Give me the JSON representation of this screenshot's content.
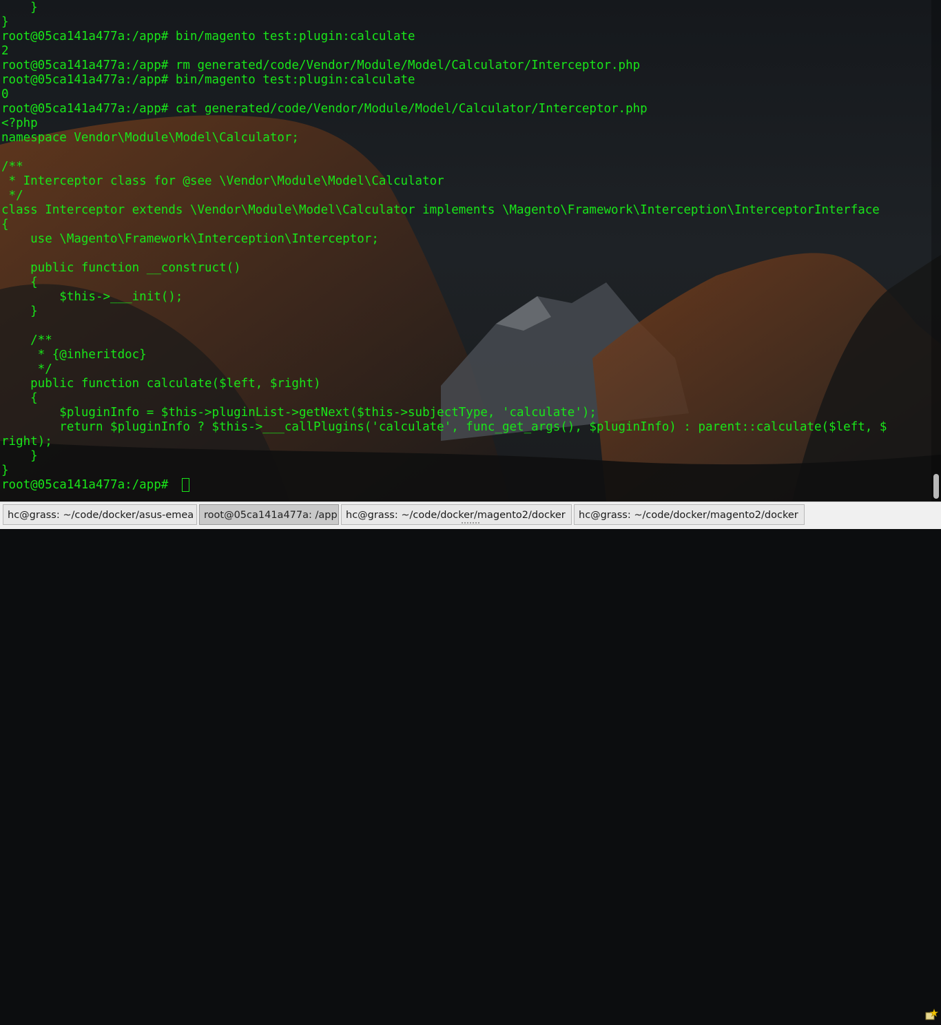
{
  "terminal": {
    "lines": [
      "    }",
      "}",
      "root@05ca141a477a:/app# bin/magento test:plugin:calculate",
      "2",
      "root@05ca141a477a:/app# rm generated/code/Vendor/Module/Model/Calculator/Interceptor.php",
      "root@05ca141a477a:/app# bin/magento test:plugin:calculate",
      "0",
      "root@05ca141a477a:/app# cat generated/code/Vendor/Module/Model/Calculator/Interceptor.php",
      "<?php",
      "namespace Vendor\\Module\\Model\\Calculator;",
      "",
      "/**",
      " * Interceptor class for @see \\Vendor\\Module\\Model\\Calculator",
      " */",
      "class Interceptor extends \\Vendor\\Module\\Model\\Calculator implements \\Magento\\Framework\\Interception\\InterceptorInterface",
      "{",
      "    use \\Magento\\Framework\\Interception\\Interceptor;",
      "",
      "    public function __construct()",
      "    {",
      "        $this->___init();",
      "    }",
      "",
      "    /**",
      "     * {@inheritdoc}",
      "     */",
      "    public function calculate($left, $right)",
      "    {",
      "        $pluginInfo = $this->pluginList->getNext($this->subjectType, 'calculate');",
      "        return $pluginInfo ? $this->___callPlugins('calculate', func_get_args(), $pluginInfo) : parent::calculate($left, $",
      "right);",
      "    }",
      "}",
      "root@05ca141a477a:/app# "
    ],
    "text_color": "#19e619"
  },
  "tabs": [
    {
      "label": "hc@grass: ~/code/docker/asus-emea",
      "active": false
    },
    {
      "label": "root@05ca141a477a: /app",
      "active": true
    },
    {
      "label": "hc@grass: ~/code/docker/magento2/docker",
      "active": false
    },
    {
      "label": "hc@grass: ~/code/docker/magento2/docker",
      "active": false
    }
  ],
  "tray": {
    "icon": "notification-star-icon"
  }
}
